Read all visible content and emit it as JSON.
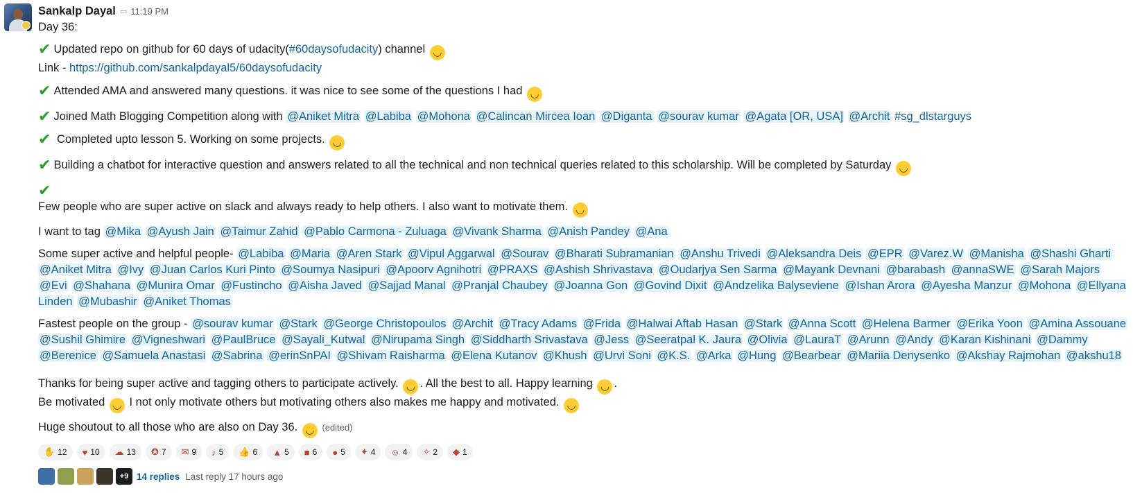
{
  "message": {
    "author": "Sankalp Dayal",
    "status_icon": "speech-balloon-icon",
    "time": "11:19 PM",
    "day": "Day 36:",
    "l1_a": "Updated repo on github for 60 days of udacity(",
    "l1_channel": "#60daysofudacity",
    "l1_b": ")  channel",
    "link_prefix": "Link - ",
    "link_url": "https://github.com/sankalpdayal5/60daysofudacity",
    "l2": "Attended AMA and answered many questions. it was nice to see some of the questions I had",
    "l3_a": "Joined Math Blogging Competition along with",
    "l3_mentions": [
      "@Aniket Mitra",
      "@Labiba",
      "@Mohona",
      "@Calincan Mircea Ioan",
      "@Diganta",
      "@sourav kumar",
      "@Agata [OR, USA]",
      "@Archit"
    ],
    "l3_channel": "#sg_dlstarguys",
    "l4": " Completed upto lesson 5. Working on some projects.",
    "l5": "Building a chatbot for interactive question and answers related to all the technical and non technical queries related to this scholarship. Will be completed by Saturday",
    "l6": "Few people who are super active on slack and always ready to help others. I also want to motivate them.",
    "tag_label": "I want to tag ",
    "tag_mentions": [
      "@Mika",
      "@Ayush Jain",
      "@Taimur Zahid",
      "@Pablo Carmona - Zuluaga",
      "@Vivank Sharma",
      "@Anish Pandey",
      "@Ana"
    ],
    "active_label": "Some super active and helpful people- ",
    "active_mentions": [
      "@Labiba",
      "@Maria",
      "@Aren Stark",
      "@Vipul Aggarwal",
      "@Sourav",
      "@Bharati Subramanian",
      "@Anshu Trivedi",
      "@Aleksandra Deis",
      "@EPR",
      "@Varez.W",
      "@Manisha",
      "@Shashi Gharti",
      "@Aniket Mitra",
      "@Ivy",
      "@Juan Carlos Kuri Pinto",
      "@Soumya Nasipuri",
      "@Apoorv Agnihotri",
      "@PRAXS",
      "@Ashish Shrivastava",
      "@Oudarjya Sen Sarma",
      "@Mayank Devnani",
      "@barabash",
      "@annaSWE",
      "@Sarah Majors",
      "@Evi",
      "@Shahana",
      "@Munira Omar",
      "@Fustincho",
      "@Aisha Javed",
      "@Sajjad Manal",
      "@Pranjal Chaubey",
      "@Joanna Gon",
      "@Govind Dixit",
      "@Andzelika Balyseviene",
      "@Ishan Arora",
      "@Ayesha Manzur",
      "@Mohona",
      "@Ellyana Linden",
      "@Mubashir",
      "@Aniket Thomas"
    ],
    "fast_label": "Fastest people on the group - ",
    "fast_mentions": [
      "@sourav kumar",
      "@Stark",
      "@George Christopoulos",
      "@Archit",
      "@Tracy Adams",
      "@Frida",
      "@Halwai Aftab Hasan",
      "@Stark",
      "@Anna Scott",
      "@Helena Barmer",
      "@Erika Yoon",
      "@Amina Assouane",
      "@Sushil Ghimire",
      "@Vigneshwari",
      "@PaulBruce",
      "@Sayali_Kutwal",
      "@Nirupama Singh",
      "@Siddharth Srivastava",
      "@Jess",
      "@Seeratpal K. Jaura",
      "@Olivia",
      "@LauraT",
      "@Arunn",
      "@Andy",
      "@Karan Kishinani",
      "@Dammy",
      "@Berenice",
      "@Samuela Anastasi",
      "@Sabrina",
      "@erinSnPAI",
      "@Shivam Raisharma",
      "@Elena Kutanov",
      "@Khush",
      "@Urvi Soni",
      "@K.S.",
      "@Arka",
      "@Hung",
      "@Bearbear",
      "@Mariia Denysenko",
      "@Akshay Rajmohan",
      "@akshu18"
    ],
    "thanks_a": "Thanks for being super active and tagging others to participate actively. ",
    "thanks_b": ". All the best to all. Happy learning ",
    "thanks_c": ".",
    "motivated_a": "Be motivated ",
    "motivated_b": " I not only motivate others but motivating others also makes me happy and motivated. ",
    "shoutout": "Huge shoutout to all those who are also on Day 36.",
    "edited": "(edited)"
  },
  "reactions": [
    {
      "icon": "clap-icon",
      "count": "12"
    },
    {
      "icon": "heart-icon",
      "count": "10"
    },
    {
      "icon": "ghost-icon",
      "count": "13"
    },
    {
      "icon": "badge-icon",
      "count": "7"
    },
    {
      "icon": "thank-you-icon",
      "count": "9"
    },
    {
      "icon": "dancing-icon",
      "count": "5"
    },
    {
      "icon": "thumbsup-icon",
      "count": "6"
    },
    {
      "icon": "party-hat-icon",
      "count": "5"
    },
    {
      "icon": "car-icon",
      "count": "6"
    },
    {
      "icon": "blob-icon",
      "count": "5"
    },
    {
      "icon": "celebrate-icon",
      "count": "4"
    },
    {
      "icon": "grin-icon",
      "count": "4"
    },
    {
      "icon": "sparkle-icon",
      "count": "2"
    },
    {
      "icon": "party-blob-icon",
      "count": "1"
    }
  ],
  "thread": {
    "more": "+9",
    "replies": "14 replies",
    "last_reply": "Last reply 17 hours ago",
    "avatar_colors": [
      "#3d6ea5",
      "#8fa04a",
      "#c9a35b",
      "#3b3327"
    ]
  },
  "colors": {
    "link": "#1264a3",
    "mention_bg": "#e8f5fa",
    "check": "#2ca02c",
    "emoji": "#ffcc33"
  }
}
